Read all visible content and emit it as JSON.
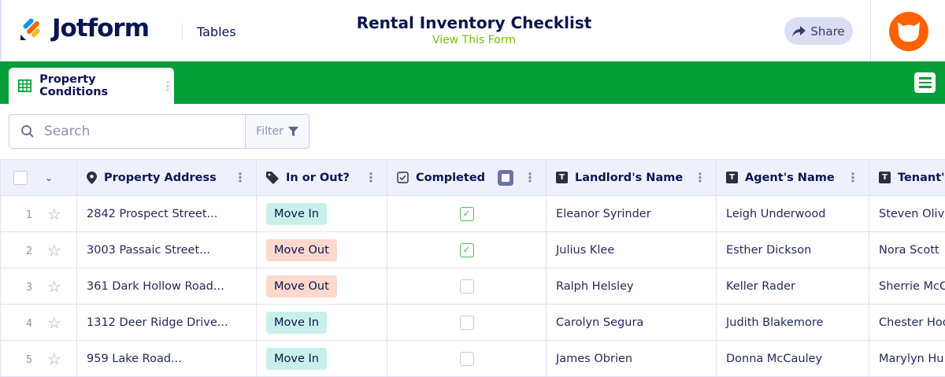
{
  "header": {
    "brand": "Jotform",
    "section": "Tables",
    "title": "Rental Inventory Checklist",
    "view_form": "View This Form",
    "share": "Share",
    "colors": {
      "brand_green": "#049e38",
      "avatar": "#ff6100",
      "view_form": "#78bb07"
    }
  },
  "tabs": [
    {
      "label": "Property Conditions",
      "icon": "grid-icon"
    }
  ],
  "toolbar": {
    "search_placeholder": "Search",
    "filter": "Filter"
  },
  "columns": [
    {
      "label": "Property Address",
      "icon": "location-pin-icon"
    },
    {
      "label": "In or Out?",
      "icon": "tag-icon"
    },
    {
      "label": "Completed",
      "icon": "checkbox-icon"
    },
    {
      "label": "Landlord's Name",
      "icon": "text-icon"
    },
    {
      "label": "Agent's Name",
      "icon": "text-icon"
    },
    {
      "label": "Tenant's",
      "icon": "text-icon"
    }
  ],
  "rows": [
    {
      "num": "1",
      "address": "2842 Prospect Street...",
      "status": "Move In",
      "completed": true,
      "landlord": "Eleanor Syrinder",
      "agent": "Leigh Underwood",
      "tenant": "Steven Olivi"
    },
    {
      "num": "2",
      "address": "3003 Passaic Street...",
      "status": "Move Out",
      "completed": true,
      "landlord": "Julius Klee",
      "agent": "Esther Dickson",
      "tenant": "Nora Scott"
    },
    {
      "num": "3",
      "address": "361 Dark Hollow Road...",
      "status": "Move Out",
      "completed": false,
      "landlord": "Ralph Helsley",
      "agent": "Keller Rader",
      "tenant": "Sherrie McC"
    },
    {
      "num": "4",
      "address": "1312 Deer Ridge Drive...",
      "status": "Move In",
      "completed": false,
      "landlord": "Carolyn Segura",
      "agent": "Judith Blakemore",
      "tenant": "Chester Hoo"
    },
    {
      "num": "5",
      "address": "959 Lake Road...",
      "status": "Move In",
      "completed": false,
      "landlord": "James Obrien",
      "agent": "Donna McCauley",
      "tenant": "Marylyn Hu"
    }
  ]
}
